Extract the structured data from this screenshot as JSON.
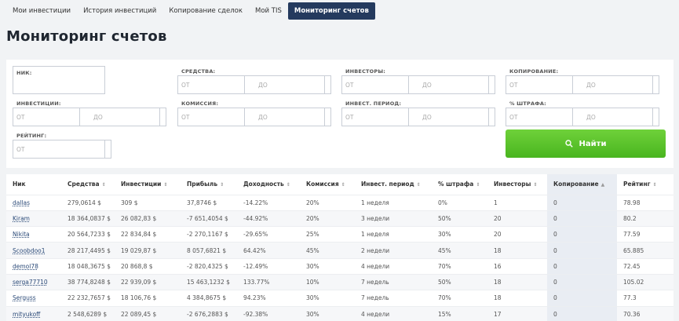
{
  "tabs": [
    "Мои инвестиции",
    "История инвестиций",
    "Копирование сделок",
    "Мой TIS",
    "Мониторинг счетов"
  ],
  "active_tab_index": 4,
  "page_title": "Мониторинг счетов",
  "filters": {
    "nick": {
      "label": "НИК:"
    },
    "funds": {
      "label": "СРЕДСТВА:",
      "from": "ОТ",
      "to": "ДО"
    },
    "investors": {
      "label": "ИНВЕСТОРЫ:",
      "from": "ОТ",
      "to": "ДО"
    },
    "copying": {
      "label": "КОПИРОВАНИЕ:",
      "from": "ОТ",
      "to": "ДО"
    },
    "investments": {
      "label": "ИНВЕСТИЦИИ:",
      "from": "ОТ",
      "to": "ДО"
    },
    "commission": {
      "label": "КОМИССИЯ:",
      "from": "ОТ",
      "to": "ДО"
    },
    "invest_period": {
      "label": "ИНВЕСТ. ПЕРИОД:",
      "from": "ОТ",
      "to": "ДО"
    },
    "penalty": {
      "label": "% ШТРАФА:",
      "from": "ОТ",
      "to": "ДО"
    },
    "rating": {
      "label": "РЕЙТИНГ:",
      "from": "ОТ"
    }
  },
  "search_button": "Найти",
  "colors": {
    "accent_tab": "#243a5e",
    "search_green": "#55bb25",
    "link": "#2b4a78"
  },
  "table": {
    "headers": [
      "Ник",
      "Средства",
      "Инвестиции",
      "Прибыль",
      "Доходность",
      "Комиссия",
      "Инвест. период",
      "% штрафа",
      "Инвесторы",
      "Копирование",
      "Рейтинг"
    ],
    "rows": [
      [
        "dallas",
        "279,0614 $",
        "309 $",
        "37,8746 $",
        "-14.22%",
        "20%",
        "1 неделя",
        "0%",
        "1",
        "0",
        "78.98"
      ],
      [
        "Kiram",
        "18 364,0837 $",
        "26 082,83 $",
        "-7 651,4054 $",
        "-44.92%",
        "20%",
        "3 недели",
        "50%",
        "20",
        "0",
        "80.2"
      ],
      [
        "Nikita",
        "20 564,7233 $",
        "22 834,84 $",
        "-2 270,1167 $",
        "-29.65%",
        "25%",
        "1 неделя",
        "30%",
        "20",
        "0",
        "77.59"
      ],
      [
        "Scoobdoo1",
        "28 217,4495 $",
        "19 029,87 $",
        "8 057,6821 $",
        "64.42%",
        "45%",
        "2 недели",
        "45%",
        "18",
        "0",
        "65.885"
      ],
      [
        "demol78",
        "18 048,3675 $",
        "20 868,8 $",
        "-2 820,4325 $",
        "-12.49%",
        "30%",
        "4 недели",
        "70%",
        "16",
        "0",
        "72.45"
      ],
      [
        "serga77710",
        "38 774,8248 $",
        "22 939,09 $",
        "15 463,1232 $",
        "133.77%",
        "10%",
        "7 недель",
        "50%",
        "18",
        "0",
        "105.02"
      ],
      [
        "Serguss",
        "22 232,7657 $",
        "18 106,76 $",
        "4 384,8675 $",
        "94.23%",
        "30%",
        "7 недель",
        "70%",
        "18",
        "0",
        "77.3"
      ],
      [
        "mityukoff",
        "2 548,6289 $",
        "22 089,45 $",
        "-2 676,2883 $",
        "-92.38%",
        "30%",
        "4 недели",
        "15%",
        "17",
        "0",
        "70.36"
      ]
    ]
  }
}
